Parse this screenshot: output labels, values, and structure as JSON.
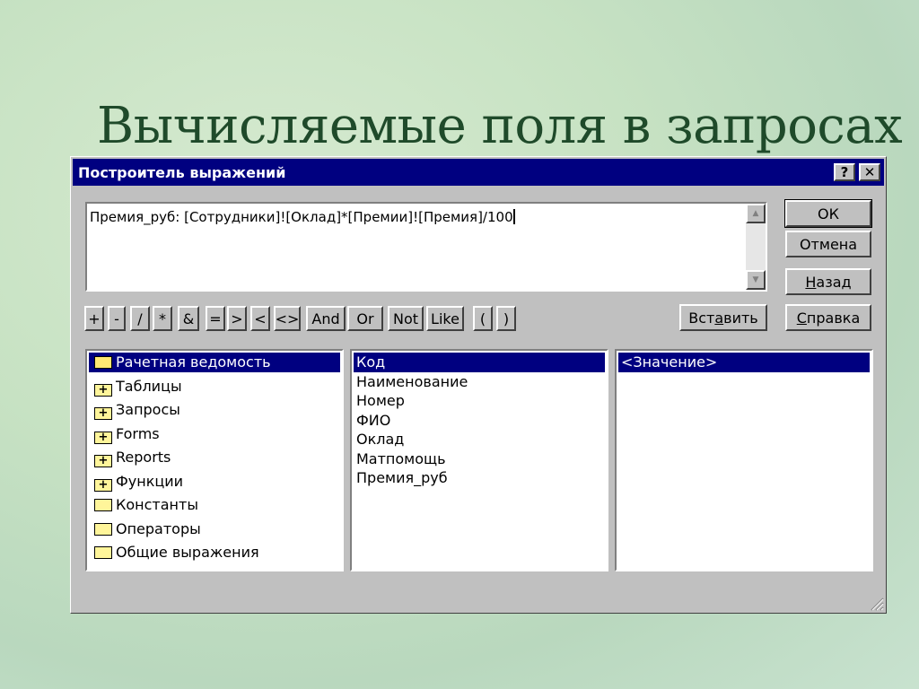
{
  "slide": {
    "title": "Вычисляемые поля в запросах"
  },
  "dialog": {
    "title": "Построитель выражений",
    "help_glyph": "?",
    "close_glyph": "✕",
    "expression": "Премия_руб: [Сотрудники]![Оклад]*[Премии]![Премия]/100",
    "buttons": {
      "ok": "ОК",
      "cancel": "Отмена",
      "back": "Назад",
      "help": "Справка",
      "paste": "Вставить"
    },
    "operators": [
      "+",
      "-",
      "/",
      "*",
      "&",
      "=",
      ">",
      "<",
      "<>",
      "And",
      "Or",
      "Not",
      "Like",
      "(",
      ")"
    ],
    "left_list": [
      {
        "label": "Рачетная ведомость",
        "icon": "open-folder-icon",
        "selected": true
      },
      {
        "label": "Таблицы",
        "icon": "plus-folder-icon"
      },
      {
        "label": "Запросы",
        "icon": "plus-folder-icon"
      },
      {
        "label": "Forms",
        "icon": "plus-folder-icon"
      },
      {
        "label": "Reports",
        "icon": "plus-folder-icon"
      },
      {
        "label": "Функции",
        "icon": "plus-folder-icon"
      },
      {
        "label": "Константы",
        "icon": "folder-icon"
      },
      {
        "label": "Операторы",
        "icon": "folder-icon"
      },
      {
        "label": "Общие выражения",
        "icon": "folder-icon"
      }
    ],
    "middle_list": [
      "Код",
      "Наименование",
      "Номер",
      "ФИО",
      "Оклад",
      "Матпомощь",
      "Премия_руб"
    ],
    "right_list": [
      "<Значение>"
    ]
  },
  "colors": {
    "titlebar": "#000080",
    "face": "#c0c0c0",
    "selection": "#000080",
    "title_text": "#1f4a2a"
  }
}
